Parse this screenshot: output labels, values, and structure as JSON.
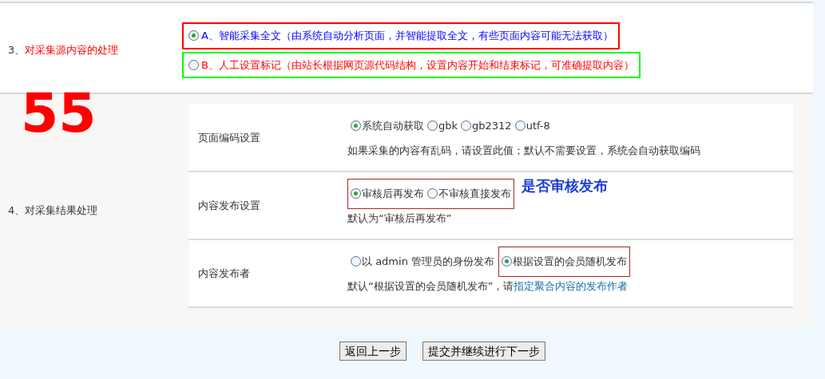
{
  "source_section": {
    "number": "3、",
    "label": "对采集源内容的处理",
    "options": [
      {
        "label": "A、智能采集全文（由系统自动分析页面，并智能提取全文，有些页面内容可能无法获取）",
        "selected": true,
        "color": "#0000ff",
        "frame": {
          "color": "#ff0000"
        }
      },
      {
        "label": "B、人工设置标记（由站长根据网页源代码结构，设置内容开始和结束标记，可准确提取内容）",
        "selected": false,
        "color": "#ff0000",
        "frame": {
          "color": "#00ff00"
        }
      }
    ]
  },
  "annotation_number": "55",
  "result_section": {
    "number": "4、",
    "label": "对采集结果处理",
    "rows": [
      {
        "label": "页面编码设置",
        "groups": [
          {
            "framed": false,
            "options": [
              {
                "label": "系统自动获取",
                "selected": true
              },
              {
                "label": "gbk",
                "selected": false
              },
              {
                "label": "gb2312",
                "selected": false
              },
              {
                "label": "utf-8",
                "selected": false
              }
            ]
          }
        ],
        "note": "如果采集的内容有乱码，请设置此值；默认不需要设置，系统会自动获取编码"
      },
      {
        "label": "内容发布设置",
        "groups": [
          {
            "framed": true,
            "options": [
              {
                "label": "审核后再发布",
                "selected": true
              },
              {
                "label": "不审核直接发布",
                "selected": false
              }
            ]
          }
        ],
        "annotation": "是否审核发布",
        "note": "默认为“审核后再发布”"
      },
      {
        "label": "内容发布者",
        "groups": [
          {
            "framed": false,
            "options": [
              {
                "label": "以 admin 管理员的身份发布",
                "selected": false
              }
            ]
          },
          {
            "framed": true,
            "options": [
              {
                "label": "根据设置的会员随机发布",
                "selected": true
              }
            ]
          }
        ],
        "note": "默认“根据设置的会员随机发布”，请",
        "note_link": "指定聚合内容的发布作者"
      }
    ]
  },
  "buttons": [
    "返回上一步",
    "提交并继续进行下一步"
  ]
}
